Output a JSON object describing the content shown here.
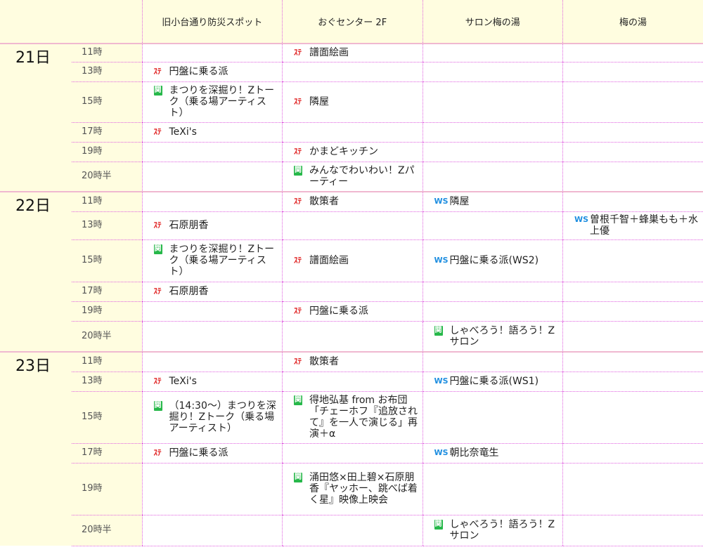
{
  "venues": [
    "旧小台通り防災スポット",
    "おぐセンター 2F",
    "サロン梅の湯",
    "梅の湯"
  ],
  "tags": {
    "stage": "ｽﾃ",
    "kan": "関",
    "ws": "WS"
  },
  "days": [
    {
      "label": "21日",
      "rows": [
        {
          "time": "11時",
          "h": 26,
          "cells": [
            null,
            {
              "type": "stage",
              "text": "譜面絵画"
            },
            null,
            null
          ]
        },
        {
          "time": "13時",
          "h": 28,
          "cells": [
            {
              "type": "stage",
              "text": "円盤に乗る派"
            },
            null,
            null,
            null
          ]
        },
        {
          "time": "15時",
          "h": 58,
          "cells": [
            {
              "type": "kan",
              "text": "まつりを深掘り！Zトーク（乗る場アーティスト）"
            },
            {
              "type": "stage",
              "text": "隣屋"
            },
            null,
            null
          ]
        },
        {
          "time": "17時",
          "h": 28,
          "cells": [
            {
              "type": "stage",
              "text": "TeXi's"
            },
            null,
            null,
            null
          ]
        },
        {
          "time": "19時",
          "h": 28,
          "cells": [
            null,
            {
              "type": "stage",
              "text": "かまどキッチン"
            },
            null,
            null
          ]
        },
        {
          "time": "20時半",
          "h": 43,
          "cells": [
            null,
            {
              "type": "kan",
              "text": "みんなでわいわい！Zパーティー"
            },
            null,
            null
          ]
        }
      ]
    },
    {
      "label": "22日",
      "rows": [
        {
          "time": "11時",
          "h": 28,
          "cells": [
            null,
            {
              "type": "stage",
              "text": "散策者"
            },
            {
              "type": "ws",
              "text": "隣屋"
            },
            null
          ]
        },
        {
          "time": "13時",
          "h": 40,
          "cells": [
            {
              "type": "stage",
              "text": "石原朋香"
            },
            null,
            null,
            {
              "type": "ws",
              "text": "曽根千智＋蜂巣もも＋水上優"
            }
          ]
        },
        {
          "time": "15時",
          "h": 60,
          "cells": [
            {
              "type": "kan",
              "text": "まつりを深掘り！Zトーク（乗る場アーティスト）"
            },
            {
              "type": "stage",
              "text": "譜面絵画"
            },
            {
              "type": "ws",
              "text": "円盤に乗る派(WS2)"
            },
            null
          ]
        },
        {
          "time": "17時",
          "h": 28,
          "cells": [
            {
              "type": "stage",
              "text": "石原朋香"
            },
            null,
            null,
            null
          ]
        },
        {
          "time": "19時",
          "h": 28,
          "cells": [
            null,
            {
              "type": "stage",
              "text": "円盤に乗る派"
            },
            null,
            null
          ]
        },
        {
          "time": "20時半",
          "h": 44,
          "cells": [
            null,
            null,
            {
              "type": "kan",
              "text": "しゃべろう！語ろう！Zサロン"
            },
            null
          ]
        }
      ]
    },
    {
      "label": "23日",
      "rows": [
        {
          "time": "11時",
          "h": 28,
          "cells": [
            null,
            {
              "type": "stage",
              "text": "散策者"
            },
            null,
            null
          ]
        },
        {
          "time": "13時",
          "h": 28,
          "cells": [
            {
              "type": "stage",
              "text": "TeXi's"
            },
            null,
            {
              "type": "ws",
              "text": "円盤に乗る派(WS1)"
            },
            null
          ]
        },
        {
          "time": "15時",
          "h": 74,
          "cells": [
            {
              "type": "kan",
              "text": "（14:30〜）まつりを深掘り！Zトーク（乗る場アーティスト）"
            },
            {
              "type": "kan",
              "text": "得地弘基 from お布団「チェーホフ『追放されて』を一人で演じる」再演＋α"
            },
            null,
            null
          ]
        },
        {
          "time": "17時",
          "h": 28,
          "cells": [
            {
              "type": "stage",
              "text": "円盤に乗る派"
            },
            null,
            {
              "type": "ws",
              "text": "朝比奈竜生"
            },
            null
          ]
        },
        {
          "time": "19時",
          "h": 74,
          "cells": [
            null,
            {
              "type": "kan",
              "text": "涌田悠×田上碧×石原朋香『ヤッホー、跳べば着く星』映像上映会"
            },
            null,
            null
          ]
        },
        {
          "time": "20時半",
          "h": 44,
          "cells": [
            null,
            null,
            {
              "type": "kan",
              "text": "しゃべろう！語ろう！Zサロン"
            },
            null
          ]
        }
      ]
    }
  ]
}
